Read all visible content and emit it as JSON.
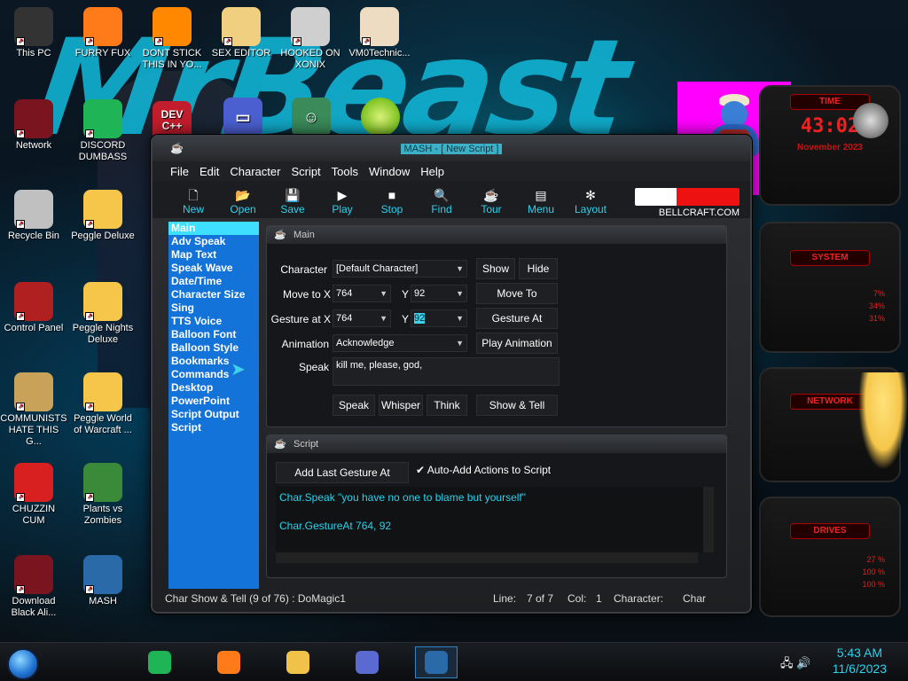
{
  "desktop": {
    "wallpaper_text": "MrBeast",
    "icons": [
      {
        "label": "This PC",
        "icon": "computer-icon",
        "color": "#333"
      },
      {
        "label": "FURRY FUX",
        "icon": "firefox-icon",
        "color": "#ff7a18"
      },
      {
        "label": "DONT STICK THIS IN YO...",
        "icon": "vlc-cone-icon",
        "color": "#ff8800"
      },
      {
        "label": "SEX EDITOR",
        "icon": "hxd-icon",
        "color": "#f0d080"
      },
      {
        "label": "HOOKED ON XONIX",
        "icon": "xonix-icon",
        "color": "#cfcfcf"
      },
      {
        "label": "VM0Technic...",
        "icon": "doctor-icon",
        "color": "#eedcc2"
      },
      {
        "label": "Network",
        "icon": "network-icon",
        "color": "#7a1520"
      },
      {
        "label": "DISCORD DUMBASS",
        "icon": "discord-icon",
        "color": "#1fb456"
      },
      {
        "label": "Recycle Bin",
        "icon": "recycle-bin-icon",
        "color": "#c0c0c0"
      },
      {
        "label": "Peggle Deluxe",
        "icon": "peggle-icon",
        "color": "#f5c64a"
      },
      {
        "label": "Control Panel",
        "icon": "control-panel-icon",
        "color": "#b02020"
      },
      {
        "label": "Peggle Nights Deluxe",
        "icon": "peggle-nights-icon",
        "color": "#f5c64a"
      },
      {
        "label": "COMMUNISTS HATE THIS G...",
        "icon": "money-bag-icon",
        "color": "#c9a25a"
      },
      {
        "label": "Peggle World of Warcraft ...",
        "icon": "peggle-wow-icon",
        "color": "#f5c64a"
      },
      {
        "label": "CHUZZIN CUM",
        "icon": "chuzzle-icon",
        "color": "#d82020"
      },
      {
        "label": "Plants vs Zombies",
        "icon": "pvz-icon",
        "color": "#3a8a3a"
      },
      {
        "label": "Download Black Ali...",
        "icon": "alien-icon",
        "color": "#7a1520"
      },
      {
        "label": "MASH",
        "icon": "mash-icon",
        "color": "#2a6aa8"
      }
    ],
    "extra_icons": [
      {
        "label": "DEV C++",
        "icon": "dev-cpp-icon"
      },
      {
        "label": "",
        "icon": "card-icon"
      },
      {
        "label": "",
        "icon": "santa-icon"
      },
      {
        "label": "",
        "icon": "lime-icon"
      }
    ]
  },
  "gadgets": {
    "clock": {
      "header": "TIME",
      "time": "43:02",
      "date": "November 2023"
    },
    "system": {
      "header": "SYSTEM",
      "rows": [
        "7%",
        "34%",
        "31%"
      ]
    },
    "network": {
      "header": "NETWORK"
    },
    "drives": {
      "header": "DRIVES",
      "rows": [
        "27 %",
        "100 %",
        "100 %"
      ]
    }
  },
  "window": {
    "title": "MASH - [ New Script ]",
    "menu": [
      "File",
      "Edit",
      "Character",
      "Script",
      "Tools",
      "Window",
      "Help"
    ],
    "toolbar": [
      {
        "label": "New",
        "icon": "new-file-icon",
        "glyph": "🗋"
      },
      {
        "label": "Open",
        "icon": "open-folder-icon",
        "glyph": "📂"
      },
      {
        "label": "Save",
        "icon": "save-disk-icon",
        "glyph": "💾"
      },
      {
        "label": "Play",
        "icon": "play-icon",
        "glyph": "▶"
      },
      {
        "label": "Stop",
        "icon": "stop-icon",
        "glyph": "■"
      },
      {
        "label": "Find",
        "icon": "find-icon",
        "glyph": "🔍"
      },
      {
        "label": "Tour",
        "icon": "tour-icon",
        "glyph": "☕"
      },
      {
        "label": "Menu",
        "icon": "menu-icon",
        "glyph": "▤"
      },
      {
        "label": "Layout",
        "icon": "layout-icon",
        "glyph": "✻"
      }
    ],
    "brand": "BELLCRAFT.COM",
    "sidebar": [
      "Main",
      "Adv Speak",
      "Map Text",
      "Speak Wave",
      "Date/Time",
      "Character Size",
      "Sing",
      "TTS Voice",
      "Balloon Font",
      "Balloon Style",
      "Bookmarks",
      "Commands",
      "Desktop",
      "PowerPoint",
      "Script Output",
      "Script"
    ],
    "main_panel": {
      "title": "Main",
      "character_label": "Character",
      "character_value": "[Default Character]",
      "show_btn": "Show",
      "hide_btn": "Hide",
      "moveto_label": "Move to X",
      "moveto_x": "764",
      "y_label": "Y",
      "moveto_y": "92",
      "moveto_btn": "Move To",
      "gesture_label": "Gesture at X",
      "gesture_x": "764",
      "gesture_y": "92",
      "gesture_btn": "Gesture At",
      "animation_label": "Animation",
      "animation_value": "Acknowledge",
      "play_anim_btn": "Play Animation",
      "speak_label": "Speak",
      "speak_text": "kill me, please, god,",
      "speak_btn": "Speak",
      "whisper_btn": "Whisper",
      "think_btn": "Think",
      "showtell_btn": "Show & Tell"
    },
    "script_panel": {
      "title": "Script",
      "add_gesture_btn": "Add Last Gesture At",
      "auto_add_label": "Auto-Add Actions to Script",
      "lines": [
        "Char.Speak \"you have no one to blame but yourself\"",
        "Char.GestureAt 764, 92"
      ]
    },
    "status": {
      "left": "Char Show & Tell (9 of 76) : DoMagic1",
      "line_label": "Line:",
      "line_value": "7 of 7",
      "col_label": "Col:",
      "col_value": "1",
      "char_label": "Character:",
      "char_value": "Char"
    }
  },
  "taskbar": {
    "apps": [
      {
        "name": "spotify",
        "icon": "spotify-icon",
        "color": "#1fb456"
      },
      {
        "name": "firefox",
        "icon": "firefox-icon",
        "color": "#ff7a18"
      },
      {
        "name": "file-explorer",
        "icon": "folder-icon",
        "color": "#f0c24a"
      },
      {
        "name": "card-app",
        "icon": "card-icon",
        "color": "#5a6ad0"
      },
      {
        "name": "mash",
        "icon": "mash-icon",
        "color": "#2a6aa8"
      }
    ],
    "clock_time": "5:43 AM",
    "clock_date": "11/6/2023"
  }
}
